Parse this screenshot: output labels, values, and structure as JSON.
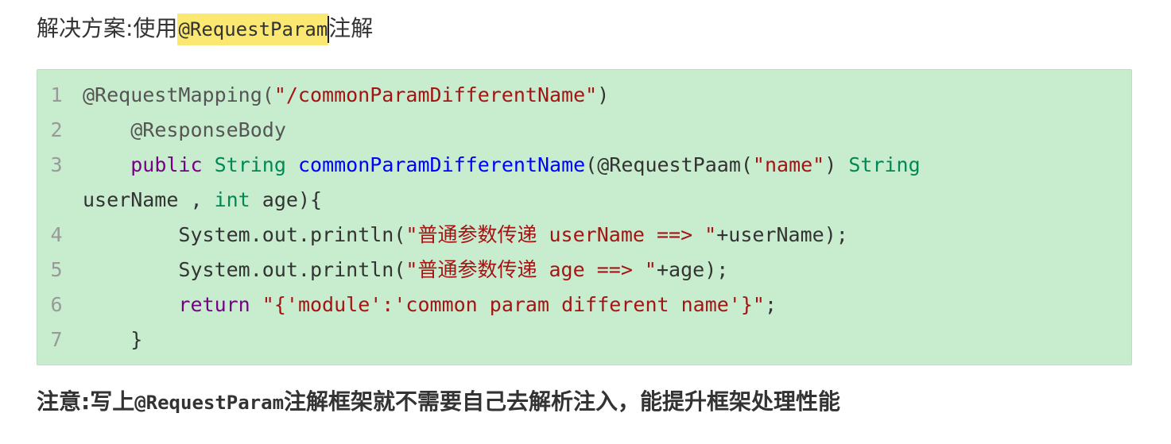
{
  "heading": {
    "prefix": "解决方案:使用",
    "highlight": "@RequestParam",
    "suffix": "注解"
  },
  "code": {
    "lines": [
      {
        "num": "1",
        "indent": "",
        "tokens": [
          {
            "t": "@RequestMapping(",
            "c": "anno"
          },
          {
            "t": "\"/commonParamDifferentName\"",
            "c": "str"
          },
          {
            "t": ")",
            "c": "plain"
          }
        ]
      },
      {
        "num": "2",
        "indent": "    ",
        "tokens": [
          {
            "t": "@ResponseBody",
            "c": "anno"
          }
        ]
      },
      {
        "num": "3",
        "indent": "    ",
        "tokens": [
          {
            "t": "public",
            "c": "kw"
          },
          {
            "t": " ",
            "c": "plain"
          },
          {
            "t": "String",
            "c": "typ"
          },
          {
            "t": " ",
            "c": "plain"
          },
          {
            "t": "commonParamDifferentName",
            "c": "fn"
          },
          {
            "t": "(@RequestPaam(",
            "c": "plain"
          },
          {
            "t": "\"name\"",
            "c": "str"
          },
          {
            "t": ") ",
            "c": "plain"
          },
          {
            "t": "String",
            "c": "typ"
          }
        ]
      },
      {
        "num": "",
        "indent": "",
        "tokens": [
          {
            "t": "userName , ",
            "c": "plain"
          },
          {
            "t": "int",
            "c": "typ"
          },
          {
            "t": " age){",
            "c": "plain"
          }
        ]
      },
      {
        "num": "4",
        "indent": "        ",
        "tokens": [
          {
            "t": "System.out.println(",
            "c": "plain"
          },
          {
            "t": "\"普通参数传递 userName ==> \"",
            "c": "str"
          },
          {
            "t": "+userName);",
            "c": "plain"
          }
        ]
      },
      {
        "num": "5",
        "indent": "        ",
        "tokens": [
          {
            "t": "System.out.println(",
            "c": "plain"
          },
          {
            "t": "\"普通参数传递 age ==> \"",
            "c": "str"
          },
          {
            "t": "+age);",
            "c": "plain"
          }
        ]
      },
      {
        "num": "6",
        "indent": "        ",
        "tokens": [
          {
            "t": "return",
            "c": "kw"
          },
          {
            "t": " ",
            "c": "plain"
          },
          {
            "t": "\"{'module':'common param different name'}\"",
            "c": "str"
          },
          {
            "t": ";",
            "c": "plain"
          }
        ]
      },
      {
        "num": "7",
        "indent": "    ",
        "tokens": [
          {
            "t": "}",
            "c": "plain"
          }
        ]
      }
    ]
  },
  "note": {
    "prefix": "注意:写上",
    "mono": "@RequestParam",
    "suffix": "注解框架就不需要自己去解析注入，能提升框架处理性能"
  }
}
